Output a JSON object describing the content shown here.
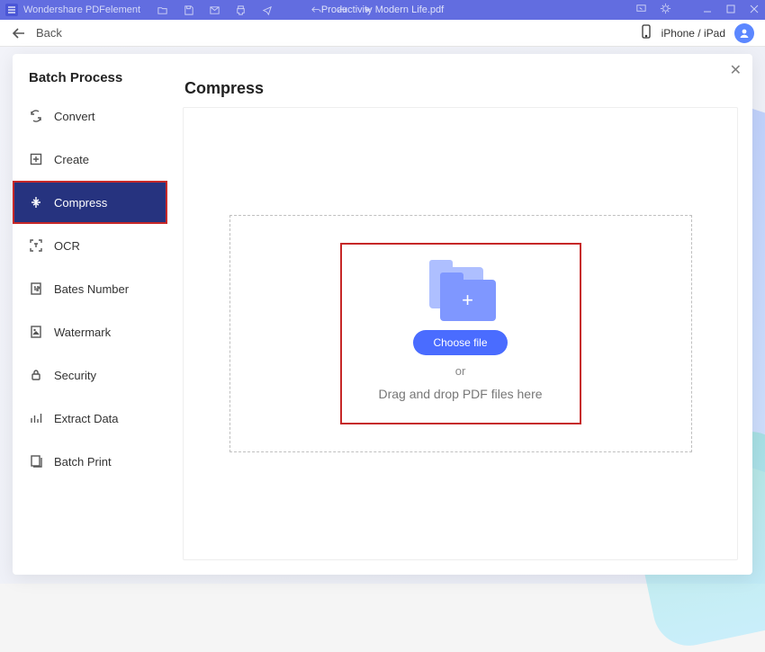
{
  "titlebar": {
    "app_name": "Wondershare PDFelement",
    "document_title": "Productivity Modern Life.pdf"
  },
  "subbar": {
    "back_label": "Back",
    "device_label": "iPhone / iPad"
  },
  "sidebar": {
    "title": "Batch Process",
    "items": [
      {
        "label": "Convert"
      },
      {
        "label": "Create"
      },
      {
        "label": "Compress"
      },
      {
        "label": "OCR"
      },
      {
        "label": "Bates Number"
      },
      {
        "label": "Watermark"
      },
      {
        "label": "Security"
      },
      {
        "label": "Extract Data"
      },
      {
        "label": "Batch Print"
      }
    ],
    "active_index": 2
  },
  "main": {
    "heading": "Compress",
    "choose_file_label": "Choose file",
    "or_label": "or",
    "dnd_label": "Drag and drop PDF files here",
    "close_label": "✕"
  }
}
